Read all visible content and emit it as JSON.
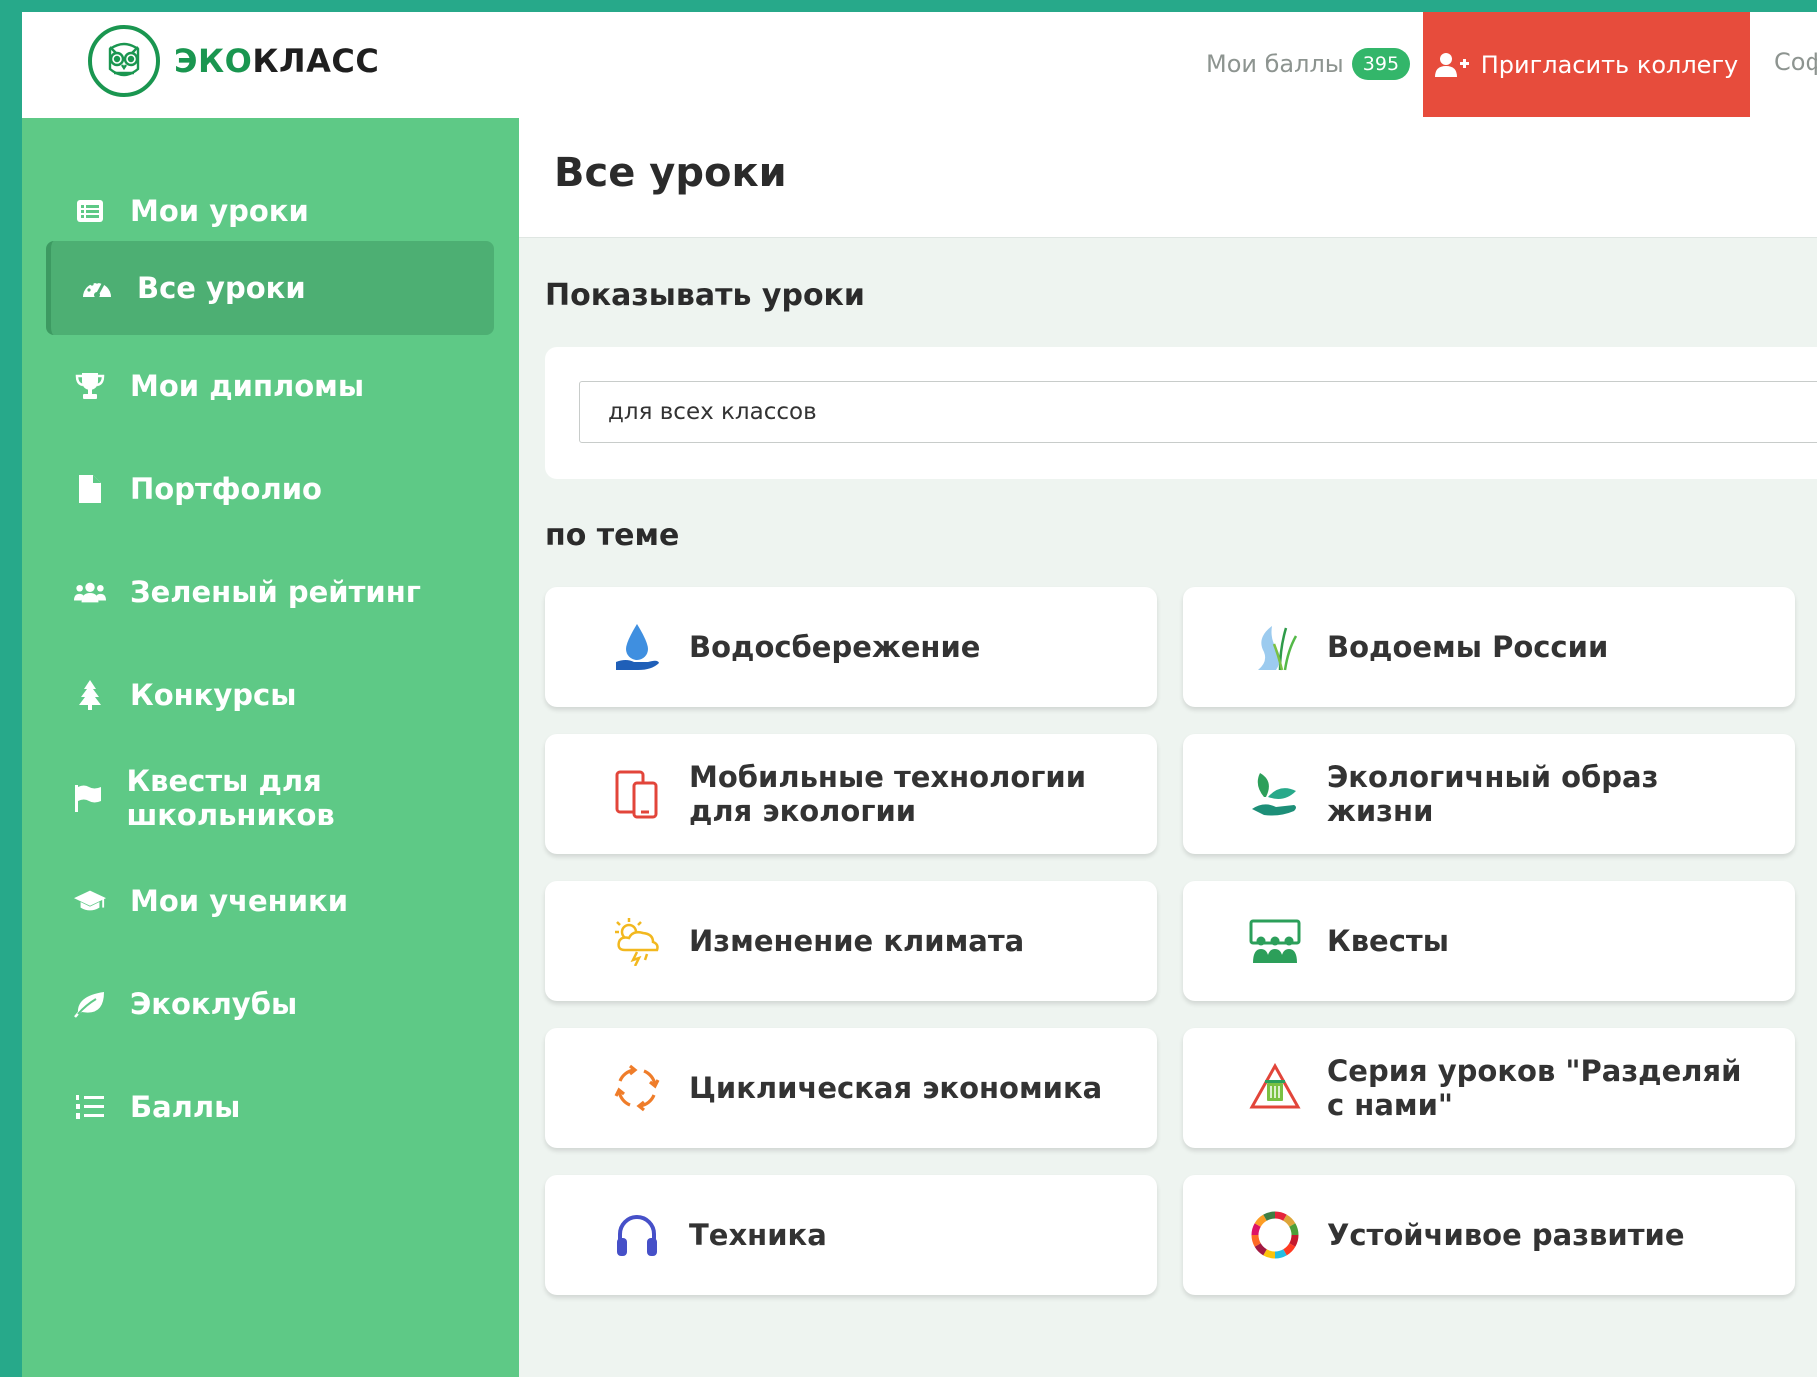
{
  "header": {
    "logo_prefix": "ЭКО",
    "logo_suffix": "КЛАСС",
    "points_label": "Мои баллы",
    "points_value": "395",
    "invite_label": "Пригласить коллегу",
    "truncated_link": "Соф"
  },
  "sidebar": {
    "items": [
      {
        "label": "Мои уроки",
        "icon": "list-card-icon"
      },
      {
        "label": "Все уроки",
        "icon": "dashboard-icon",
        "active": true
      },
      {
        "label": "Мои дипломы",
        "icon": "trophy-icon"
      },
      {
        "label": "Портфолио",
        "icon": "file-icon"
      },
      {
        "label": "Зеленый рейтинг",
        "icon": "users-icon"
      },
      {
        "label": "Конкурсы",
        "icon": "tree-icon"
      },
      {
        "label": "Квесты для школьников",
        "icon": "flag-icon"
      },
      {
        "label": "Мои ученики",
        "icon": "graduation-cap-icon"
      },
      {
        "label": "Экоклубы",
        "icon": "leaf-icon"
      },
      {
        "label": "Баллы",
        "icon": "list-ol-icon"
      }
    ]
  },
  "main": {
    "page_title": "Все уроки",
    "show_lessons_title": "Показывать уроки",
    "grade_select_value": "для всех классов",
    "topic_title": "по теме",
    "topics": [
      {
        "label": "Водосбережение",
        "icon": "water-drop-hand-icon"
      },
      {
        "label": "Водоемы России",
        "icon": "river-reeds-icon"
      },
      {
        "label": "Мобильные технологии для экологии",
        "icon": "mobile-devices-icon"
      },
      {
        "label": "Экологичный образ жизни",
        "icon": "sprout-hand-icon"
      },
      {
        "label": "Изменение климата",
        "icon": "storm-cloud-sun-icon"
      },
      {
        "label": "Квесты",
        "icon": "group-board-icon"
      },
      {
        "label": "Циклическая экономика",
        "icon": "cycle-arrows-icon"
      },
      {
        "label": "Серия уроков \"Разделяй с нами\"",
        "icon": "recycle-bin-icon"
      },
      {
        "label": "Техника",
        "icon": "headphones-icon"
      },
      {
        "label": "Устойчивое развитие",
        "icon": "sdg-wheel-icon"
      }
    ]
  },
  "colors": {
    "sidebar": "#5ec986",
    "sidebar_active": "#4daf73",
    "invite": "#e74c3c",
    "badge": "#33b66a",
    "outer": "#27a98a",
    "logo_green": "#1a9650"
  }
}
